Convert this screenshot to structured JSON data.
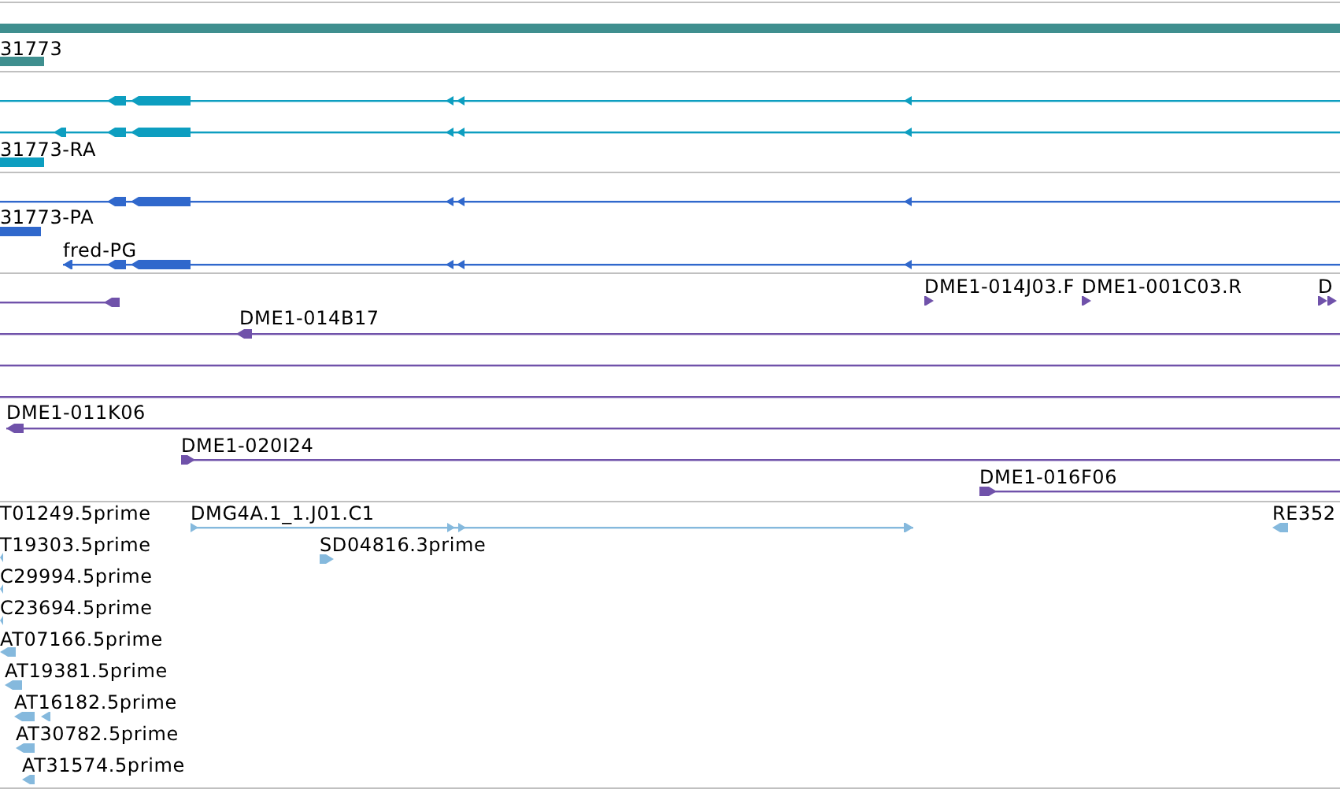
{
  "tracks": [
    {
      "color": "#3f8f8f",
      "features": [
        {
          "kind": "bar"
        },
        {
          "kind": "bar",
          "label": "31773"
        }
      ]
    },
    {
      "color": "#0d9ec0",
      "features": [
        {
          "kind": "transcript",
          "reverse": true
        },
        {
          "kind": "transcript",
          "reverse": true
        },
        {
          "kind": "bar",
          "label": "31773-RA"
        }
      ]
    },
    {
      "color": "#3068cc",
      "features": [
        {
          "kind": "transcript",
          "reverse": true
        },
        {
          "kind": "bar",
          "label": "31773-PA"
        },
        {
          "kind": "transcript",
          "reverse": true,
          "label": "fred-PG"
        }
      ]
    },
    {
      "color": "#7052aa",
      "features": [
        {
          "kind": "clone",
          "reverse": true
        },
        {
          "kind": "marker",
          "reverse": false,
          "label": "DME1-014J03.F"
        },
        {
          "kind": "marker",
          "reverse": false,
          "label": "DME1-001C03.R"
        },
        {
          "kind": "marker",
          "reverse": false,
          "label": "D"
        },
        {
          "kind": "clone",
          "reverse": true,
          "label": "DME1-014B17"
        },
        {
          "kind": "clone"
        },
        {
          "kind": "clone"
        },
        {
          "kind": "clone",
          "reverse": true,
          "label": "DME1-011K06"
        },
        {
          "kind": "clone",
          "reverse": false,
          "label": "DME1-020I24"
        },
        {
          "kind": "clone",
          "reverse": false,
          "label": "DME1-016F06"
        }
      ]
    },
    {
      "color": "#85b9dd",
      "features": [
        {
          "kind": "est",
          "label": "T01249.5prime"
        },
        {
          "kind": "clone",
          "reverse": false,
          "label": "DMG4A.1_1.J01.C1"
        },
        {
          "kind": "est",
          "reverse": true,
          "label": "RE352"
        },
        {
          "kind": "est",
          "reverse": true,
          "label": "T19303.5prime"
        },
        {
          "kind": "est",
          "reverse": false,
          "label": "SD04816.3prime"
        },
        {
          "kind": "est",
          "reverse": true,
          "label": "C29994.5prime"
        },
        {
          "kind": "est",
          "reverse": true,
          "label": "C23694.5prime"
        },
        {
          "kind": "est",
          "reverse": true,
          "label": "AT07166.5prime"
        },
        {
          "kind": "est",
          "reverse": true,
          "label": "AT19381.5prime"
        },
        {
          "kind": "est",
          "reverse": true,
          "label": "AT16182.5prime"
        },
        {
          "kind": "est",
          "reverse": true,
          "label": "AT30782.5prime"
        },
        {
          "kind": "est",
          "reverse": true,
          "label": "AT31574.5prime"
        }
      ]
    }
  ]
}
